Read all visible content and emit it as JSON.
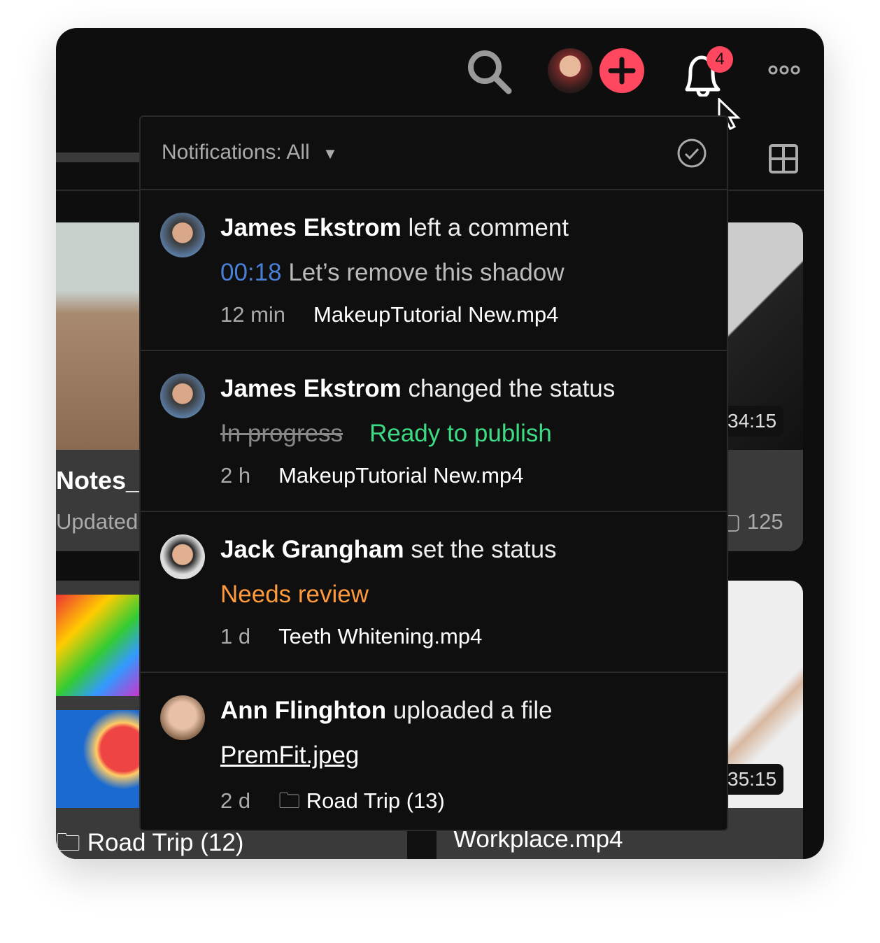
{
  "topbar": {
    "notification_count": "4",
    "icons": [
      "search-icon",
      "avatar",
      "add-icon",
      "bell-icon",
      "more-icon"
    ]
  },
  "background": {
    "card1_title": "Notes_",
    "card1_sub": "Updated",
    "card2_duration": "34:15",
    "card2_comments": "125",
    "card4_duration": "35:15",
    "folder_label": "Road Trip (12)",
    "file_label": "Workplace.mp4"
  },
  "panel": {
    "filter_label": "Notifications: All",
    "items": [
      {
        "name": "James Ekstrom",
        "action": "left a comment",
        "timecode": "00:18",
        "comment": "Let’s remove this shadow",
        "time": "12 min",
        "file": "MakeupTutorial New.mp4"
      },
      {
        "name": "James Ekstrom",
        "action": "changed the status",
        "old_status": "In progress",
        "new_status": "Ready to publish",
        "time": "2 h",
        "file": "MakeupTutorial New.mp4"
      },
      {
        "name": "Jack Grangham",
        "action": "set the status",
        "status": "Needs review",
        "time": "1 d",
        "file": "Teeth Whitening.mp4"
      },
      {
        "name": "Ann Flinghton",
        "action": "uploaded a file",
        "link": "PremFit.jpeg",
        "time": "2 d",
        "folder": "Road Trip (13)"
      }
    ]
  },
  "colors": {
    "accent_red": "#ff4760",
    "timecode_blue": "#4a7fd6",
    "ready_green": "#3ddc84",
    "review_orange": "#ff9a3c"
  }
}
